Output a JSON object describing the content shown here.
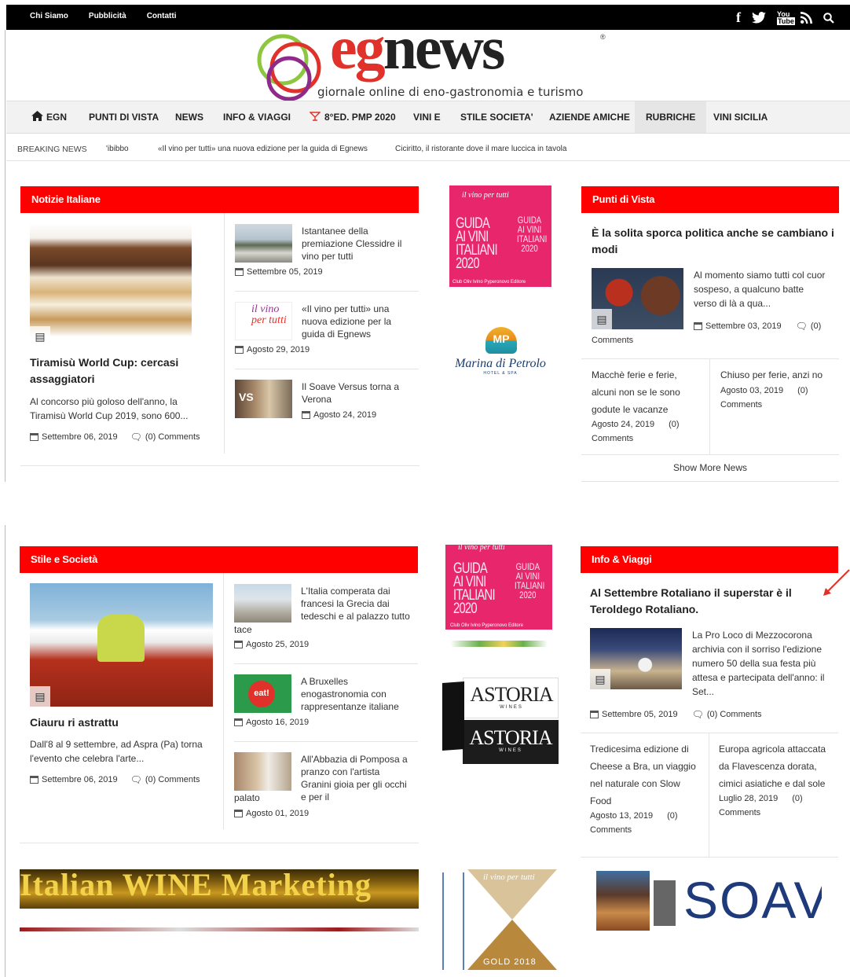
{
  "topbar": {
    "links": [
      "Chi Siamo",
      "Pubblicità",
      "Contatti"
    ],
    "icons": [
      "facebook-icon",
      "twitter-icon",
      "youtube-icon",
      "rss-icon",
      "search-icon"
    ]
  },
  "logo": {
    "eg": "eg",
    "news": "news",
    "reg": "®",
    "tagline": "giornale online di eno-gastronomia e turismo"
  },
  "nav": {
    "items": [
      "EGN",
      "PUNTI DI VISTA",
      "NEWS",
      "INFO & VIAGGI",
      "8°ED. PMP 2020",
      "VINI E",
      "STILE SOCIETA'",
      "AZIENDE AMICHE",
      "RUBRICHE",
      "VINI SICILIA"
    ]
  },
  "breaking": {
    "label": "BREAKING NEWS",
    "items": [
      "'ibibbo",
      "«Il vino per tutti» una nuova edizione per la guida di Egnews",
      "Ciciritto, il ristorante dove il mare luccica in tavola"
    ]
  },
  "comments_word": "Comments",
  "notizie": {
    "header": "Notizie Italiane",
    "main": {
      "title": "Tiramisù World Cup: cercasi assaggiatori",
      "excerpt": "Al concorso più goloso dell'anno, la Tiramisù World Cup 2019, sono 600...",
      "date": "Settembre 06, 2019",
      "comments": "(0) Comments"
    },
    "list": [
      {
        "title": "Istantanee della premiazione Clessidre il vino per tutti",
        "date": "Settembre 05, 2019"
      },
      {
        "title": "«Il vino per tutti» una nuova edizione per la guida di Egnews",
        "date": "Agosto 29, 2019"
      },
      {
        "title": "Il Soave Versus torna a Verona",
        "date": "Agosto 24, 2019"
      }
    ]
  },
  "ads": {
    "book": {
      "top": "il vino per tutti",
      "left": "GUIDA AI VINI ITALIANI 2020",
      "right": "GUIDA AI VINI ITALIANI 2020",
      "footer": "Club Oliv Ivino Pyperonovo Editore"
    },
    "marina": {
      "mark": "MP",
      "name": "Marina di Petrolo",
      "sub": "HOTEL & SPA"
    },
    "astoria": "ASTORIA",
    "astoria_sub": "WINES",
    "iwm": "Italian WINE Marketing",
    "gold": {
      "top": "il vino per tutti",
      "bottom": "GOLD 2018"
    },
    "soave": "SOAV"
  },
  "punti": {
    "header": "Punti di Vista",
    "main": {
      "title": "È la solita sporca politica anche se cambiano i modi",
      "excerpt": "Al momento siamo tutti col cuor sospeso, a qualcuno batte verso di là a qua...",
      "date": "Settembre 03, 2019",
      "comments": "(0)"
    },
    "left": {
      "title": "Macchè ferie e ferie, alcuni non se le sono godute le vacanze",
      "date": "Agosto 24, 2019",
      "comments": "(0)"
    },
    "right": {
      "title": "Chiuso per ferie, anzi no",
      "date": "Agosto 03, 2019",
      "comments": "(0)"
    },
    "more": "Show More News"
  },
  "stile": {
    "header": "Stile e Società",
    "main": {
      "title": "Ciauru ri astrattu",
      "excerpt": "Dall'8 al 9 settembre, ad Aspra (Pa) torna l'evento che celebra l'arte...",
      "date": "Settembre 06, 2019",
      "comments": "(0) Comments"
    },
    "list": [
      {
        "title": "L'Italia comperata dai francesi la Grecia dai tedeschi e al palazzo tutto",
        "tail": "tace",
        "date": "Agosto 25, 2019"
      },
      {
        "title": "A Bruxelles enogastronomia con rappresentanze italiane",
        "tail": "",
        "date": "Agosto 16, 2019",
        "thumb": "eat!"
      },
      {
        "title": "All'Abbazia di Pomposa a pranzo con l'artista Granini gioia per gli occhi e per il",
        "tail": "palato",
        "date": "Agosto 01, 2019"
      }
    ]
  },
  "info": {
    "header": "Info & Viaggi",
    "main": {
      "title": "Al Settembre Rotaliano il superstar è il Teroldego Rotaliano.",
      "excerpt": "La Pro Loco di Mezzocorona archivia con il sorriso l'edizione numero 50 della sua festa più attesa e partecipata dell'anno: il Set...",
      "date": "Settembre 05, 2019",
      "comments": "(0) Comments"
    },
    "left": {
      "title": "Tredicesima edizione di Cheese a Bra, un viaggio nel naturale con Slow Food",
      "date": "Agosto 13, 2019",
      "comments": "(0)"
    },
    "right": {
      "title": "Europa agricola attaccata da Flavescenza dorata, cimici asiatiche e dal sole",
      "date": "Luglio 28, 2019",
      "comments": "(0)"
    }
  },
  "colors": {
    "red": "#ff0000",
    "black": "#000000",
    "pink": "#e8266c"
  }
}
